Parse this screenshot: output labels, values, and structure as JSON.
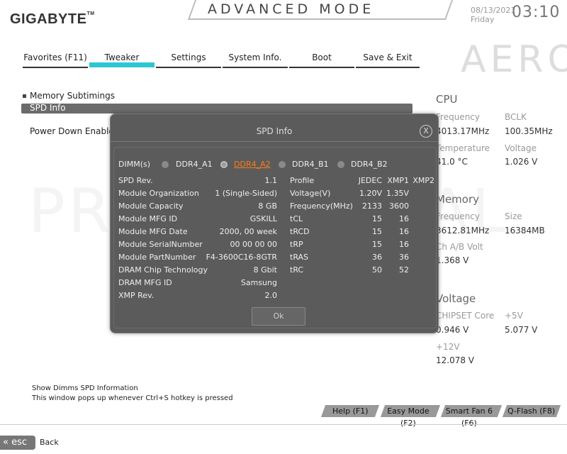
{
  "header": {
    "brand": "GIGABYTE",
    "brand_tm": "TM",
    "mode": "ADVANCED MODE",
    "date": "08/13/2021",
    "day": "Friday",
    "time": "03:10",
    "logo": "AERO"
  },
  "tabs": [
    {
      "label": "Favorites (F11)",
      "active": false
    },
    {
      "label": "Tweaker",
      "active": true
    },
    {
      "label": "Settings",
      "active": false
    },
    {
      "label": "System Info.",
      "active": false
    },
    {
      "label": "Boot",
      "active": false
    },
    {
      "label": "Save & Exit",
      "active": false
    }
  ],
  "left_menu": {
    "memory_subtimings": "Memory Subtimings",
    "spd_info": "SPD Info",
    "power_down": "Power Down Enable"
  },
  "right_panel": {
    "cpu_title": "CPU",
    "cpu_freq_label": "Frequency",
    "cpu_bclk_label": "BCLK",
    "cpu_freq_value": "4013.17MHz",
    "cpu_bclk_value": "100.35MHz",
    "cpu_temp_label": "Temperature",
    "cpu_volt_label": "Voltage",
    "cpu_temp_value": "41.0 °C",
    "cpu_volt_value": "1.026 V",
    "mem_title": "Memory",
    "mem_freq_label": "Frequency",
    "mem_size_label": "Size",
    "mem_freq_value": "3612.81MHz",
    "mem_size_value": "16384MB",
    "mem_volt_label": "Ch A/B Volt",
    "mem_volt_value": "1.368 V",
    "volt_title": "Voltage",
    "chipset_label": "CHIPSET Core",
    "plus5_label": "+5V",
    "chipset_value": "0.946 V",
    "plus5_value": "5.077 V",
    "plus12_label": "+12V",
    "plus12_value": "12.078 V"
  },
  "watermark": "PRO FESIONAL",
  "dialog": {
    "title": "SPD Info",
    "close": "X",
    "dimm_label": "DIMM(s)",
    "slots": [
      {
        "label": "DDR4_A1",
        "selected": false
      },
      {
        "label": "DDR4_A2",
        "selected": true
      },
      {
        "label": "DDR4_B1",
        "selected": false
      },
      {
        "label": "DDR4_B2",
        "selected": false
      }
    ],
    "left_rows": [
      {
        "label": "SPD Rev.",
        "value": "1.1"
      },
      {
        "label": "Module Organization",
        "value": "1 (Single-Sided)"
      },
      {
        "label": "Module Capacity",
        "value": "8 GB"
      },
      {
        "label": "Module MFG ID",
        "value": "GSKILL"
      },
      {
        "label": "Module MFG Date",
        "value": "2000, 00 week"
      },
      {
        "label": "Module SerialNumber",
        "value": "00 00 00 00"
      },
      {
        "label": "Module PartNumber",
        "value": "F4-3600C16-8GTR"
      },
      {
        "label": "DRAM Chip Technology",
        "value": "8 Gbit"
      },
      {
        "label": "DRAM MFG ID",
        "value": "Samsung"
      },
      {
        "label": "XMP Rev.",
        "value": "2.0"
      }
    ],
    "right_header": {
      "profile": "Profile",
      "jedec": "JEDEC",
      "xmp1": "XMP1",
      "xmp2": "XMP2"
    },
    "right_rows": [
      {
        "label": "Voltage(V)",
        "jedec": "1.20V",
        "xmp1": "1.35V",
        "xmp2": ""
      },
      {
        "label": "Frequency(MHz)",
        "jedec": "2133",
        "xmp1": "3600",
        "xmp2": ""
      },
      {
        "label": "tCL",
        "jedec": "15",
        "xmp1": "16",
        "xmp2": ""
      },
      {
        "label": "tRCD",
        "jedec": "15",
        "xmp1": "16",
        "xmp2": ""
      },
      {
        "label": "tRP",
        "jedec": "15",
        "xmp1": "16",
        "xmp2": ""
      },
      {
        "label": "tRAS",
        "jedec": "36",
        "xmp1": "36",
        "xmp2": ""
      },
      {
        "label": "tRC",
        "jedec": "50",
        "xmp1": "52",
        "xmp2": ""
      }
    ],
    "ok": "Ok"
  },
  "footer": {
    "info_line1": "Show Dimms SPD Information",
    "info_line2": "This window pops up whenever Ctrl+S hotkey is pressed",
    "buttons": [
      "Help (F1)",
      "Easy Mode (F2)",
      "Smart Fan 6 (F6)",
      "Q-Flash (F8)"
    ],
    "esc": "esc",
    "back": "Back"
  }
}
